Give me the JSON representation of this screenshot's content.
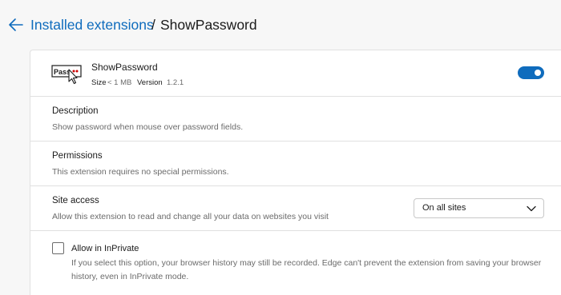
{
  "breadcrumb": {
    "parent": "Installed extensions",
    "separator": "/",
    "current": "ShowPassword"
  },
  "extension": {
    "name": "ShowPassword",
    "logo_text": "Pass",
    "size_label": "Size",
    "size_value": "< 1 MB",
    "version_label": "Version",
    "version_value": "1.2.1",
    "enabled": true
  },
  "description": {
    "title": "Description",
    "text": "Show password when mouse over password fields."
  },
  "permissions": {
    "title": "Permissions",
    "text": "This extension requires no special permissions."
  },
  "site_access": {
    "title": "Site access",
    "text": "Allow this extension to read and change all your data on websites you visit",
    "selected": "On all sites"
  },
  "inprivate": {
    "label": "Allow in InPrivate",
    "checked": false,
    "description": "If you select this option, your browser history may still be recorded. Edge can't prevent the extension from saving your browser history, even in InPrivate mode."
  },
  "colors": {
    "accent": "#0f6cbd",
    "background": "#f7f7f7",
    "card": "#ffffff",
    "secondary_text": "#6b6b6b"
  }
}
